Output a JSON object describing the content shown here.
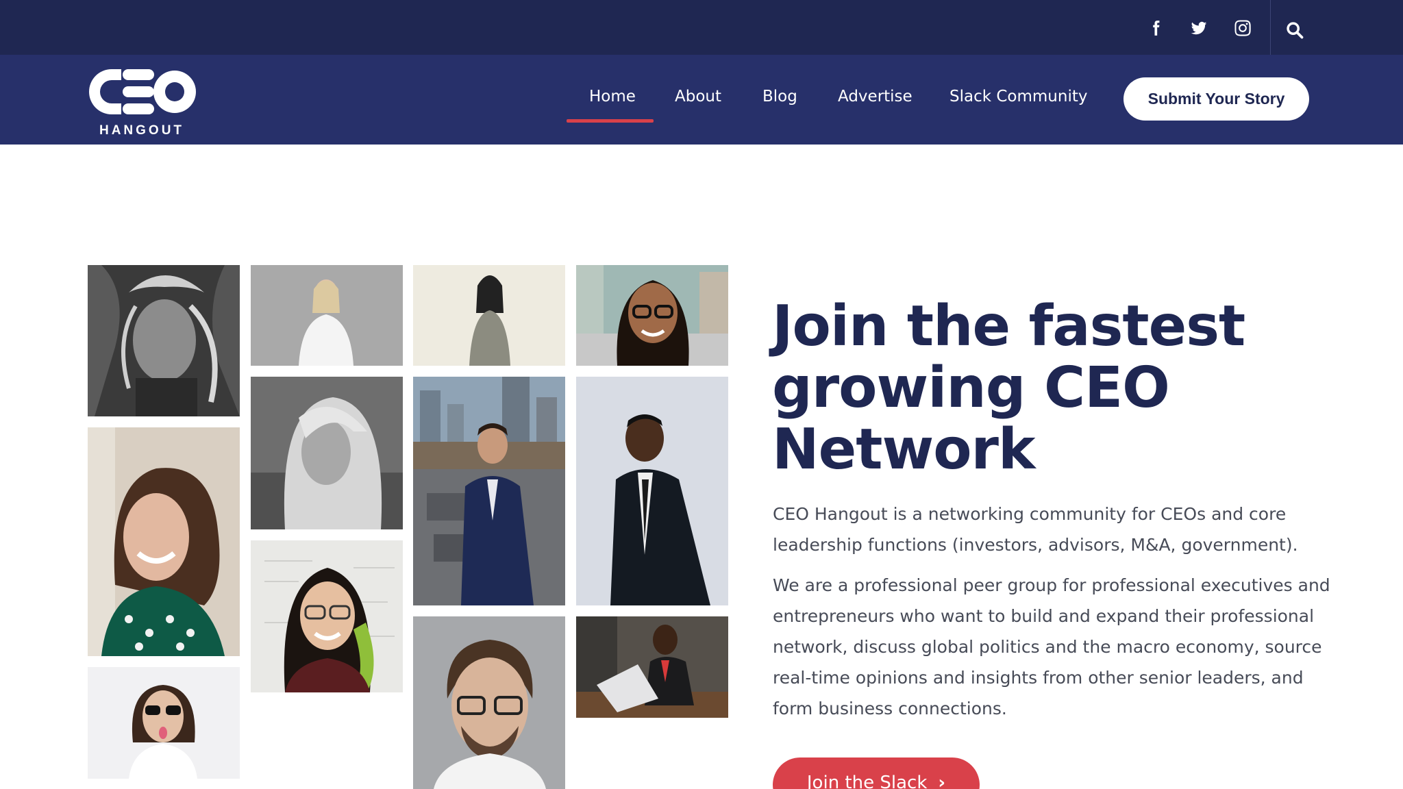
{
  "topbar": {
    "social_icons": [
      "facebook-icon",
      "twitter-icon",
      "instagram-icon"
    ],
    "search_icon": "search-icon"
  },
  "brand": {
    "logo_main": "CEO",
    "logo_sub": "HANGOUT"
  },
  "nav": {
    "items": [
      {
        "label": "Home",
        "active": true
      },
      {
        "label": "About"
      },
      {
        "label": "Blog"
      },
      {
        "label": "Advertise"
      },
      {
        "label": "Slack Community"
      }
    ],
    "cta_label": "Submit Your Story"
  },
  "hero": {
    "title": "Join the fastest growing CEO Network",
    "paragraph_1": "CEO Hangout is a networking community for CEOs and core leadership functions (investors, advisors, M&A, government).",
    "paragraph_2": "We are a professional peer group for professional executives and entrepreneurs who want to build and expand their professional network, discuss global politics and the macro economy, source real-time opinions and insights from other senior leaders, and form business connections.",
    "cta_label": "Join the Slack",
    "cta_icon": "chevron-right-icon"
  },
  "colors": {
    "topbar_bg": "#1f2752",
    "nav_bg": "#27306a",
    "heading": "#1f2752",
    "accent_red": "#d9414a"
  }
}
